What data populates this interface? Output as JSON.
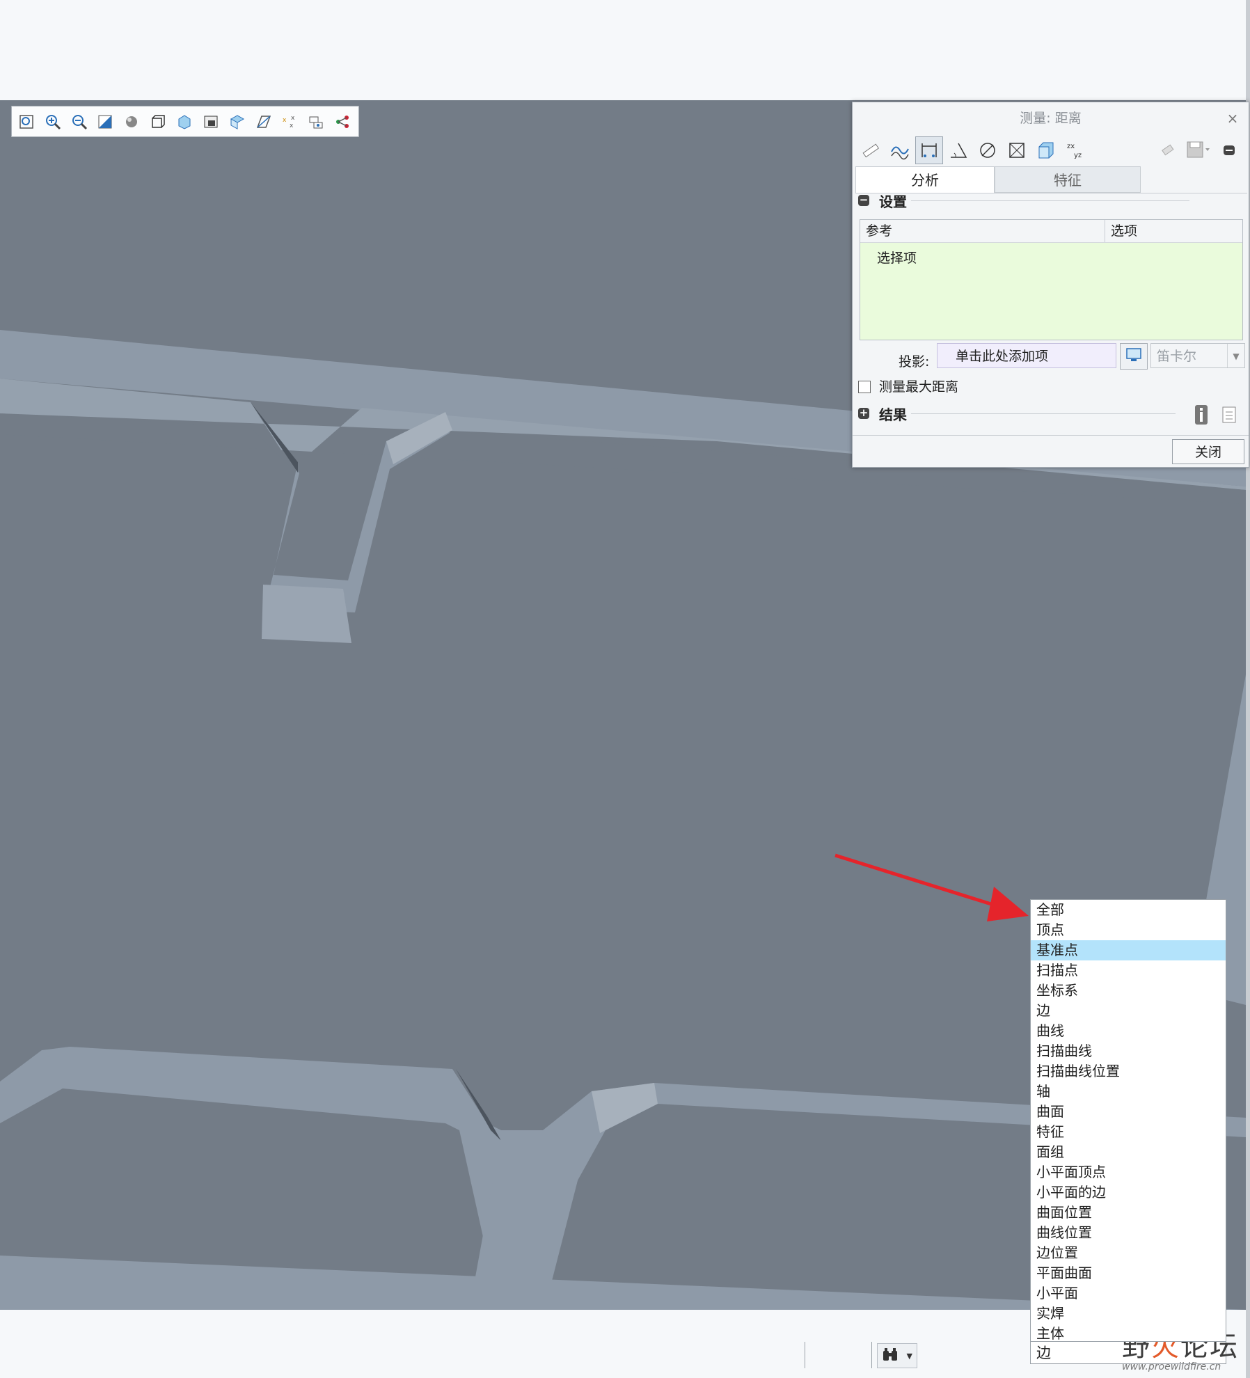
{
  "dialog": {
    "title": "测量: 距离",
    "close_glyph": "×",
    "tabs": [
      "分析",
      "特征"
    ],
    "settings_header": "设置",
    "reference_col": "参考",
    "options_col": "选项",
    "select_item": "选择项",
    "projection_label": "投影:",
    "projection_placeholder": "单击此处添加项",
    "coord_system": "笛卡尔",
    "max_distance_label": "测量最大距离",
    "results_header": "结果",
    "close_button": "关闭"
  },
  "view_toolbar_icons": [
    "refit-icon",
    "zoom-in-icon",
    "zoom-out-icon",
    "repaint-icon",
    "display-style-icon",
    "saved-orientations-icon",
    "view-manager-icon",
    "perspective-icon",
    "datum-display-icon",
    "plane-display-icon",
    "point-display-icon",
    "csys-display-icon",
    "annotation-display-icon"
  ],
  "filter": {
    "current_value": "边",
    "options": [
      "全部",
      "顶点",
      "基准点",
      "扫描点",
      "坐标系",
      "边",
      "曲线",
      "扫描曲线",
      "扫描曲线位置",
      "轴",
      "曲面",
      "特征",
      "面组",
      "小平面顶点",
      "小平面的边",
      "曲面位置",
      "曲线位置",
      "边位置",
      "平面曲面",
      "小平面",
      "实焊",
      "主体"
    ],
    "selected_option": "基准点"
  },
  "watermark": {
    "text_a": "野",
    "text_b": "火",
    "text_c": "论坛",
    "url": "www.proewildfire.cn"
  },
  "colors": {
    "viewport_bg": "#737c87",
    "model_face": "#8e9aa8",
    "highlight": "#b3e3fb",
    "arrow": "#e5242b"
  }
}
